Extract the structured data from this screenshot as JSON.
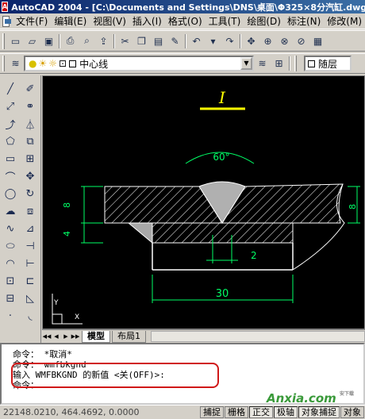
{
  "window": {
    "title": "AutoCAD 2004 - [C:\\Documents and Settings\\DNS\\桌面\\Φ325×8分汽缸.dwg]"
  },
  "menu": [
    "文件(F)",
    "编辑(E)",
    "视图(V)",
    "插入(I)",
    "格式(O)",
    "工具(T)",
    "绘图(D)",
    "标注(N)",
    "修改(M)"
  ],
  "layer_toolbar": {
    "current_layer": "中心线",
    "color_value": "随层"
  },
  "drawing": {
    "label_roman": "I",
    "dim_angle": "60°",
    "dim_left_8": "8",
    "dim_left_4": "4",
    "dim_gap": "2",
    "dim_bottom": "30",
    "dim_right_8": "8"
  },
  "tabs": {
    "model": "模型",
    "layout1": "布局1"
  },
  "command_line": {
    "line1": "命令： *取消*",
    "line2": "命令： wmfbkgnd",
    "line3": "输入 WMFBKGND 的新值 <关(OFF)>:",
    "line4": "命令："
  },
  "status": {
    "coords": "22148.0210, 464.4692, 0.0000",
    "snap": "捕捉",
    "grid": "栅格",
    "ortho": "正交",
    "polar": "极轴",
    "osnap": "对象捕捉",
    "otrack": "对象"
  },
  "watermark": {
    "brand": "Anxia.com",
    "sub": "安下载"
  },
  "colors": {
    "canvas_bg": "#000000",
    "title_bar": "#0a246a",
    "highlight_box": "#d01818",
    "drawing_line": "#ffffff",
    "center_line": "#ffff00"
  }
}
